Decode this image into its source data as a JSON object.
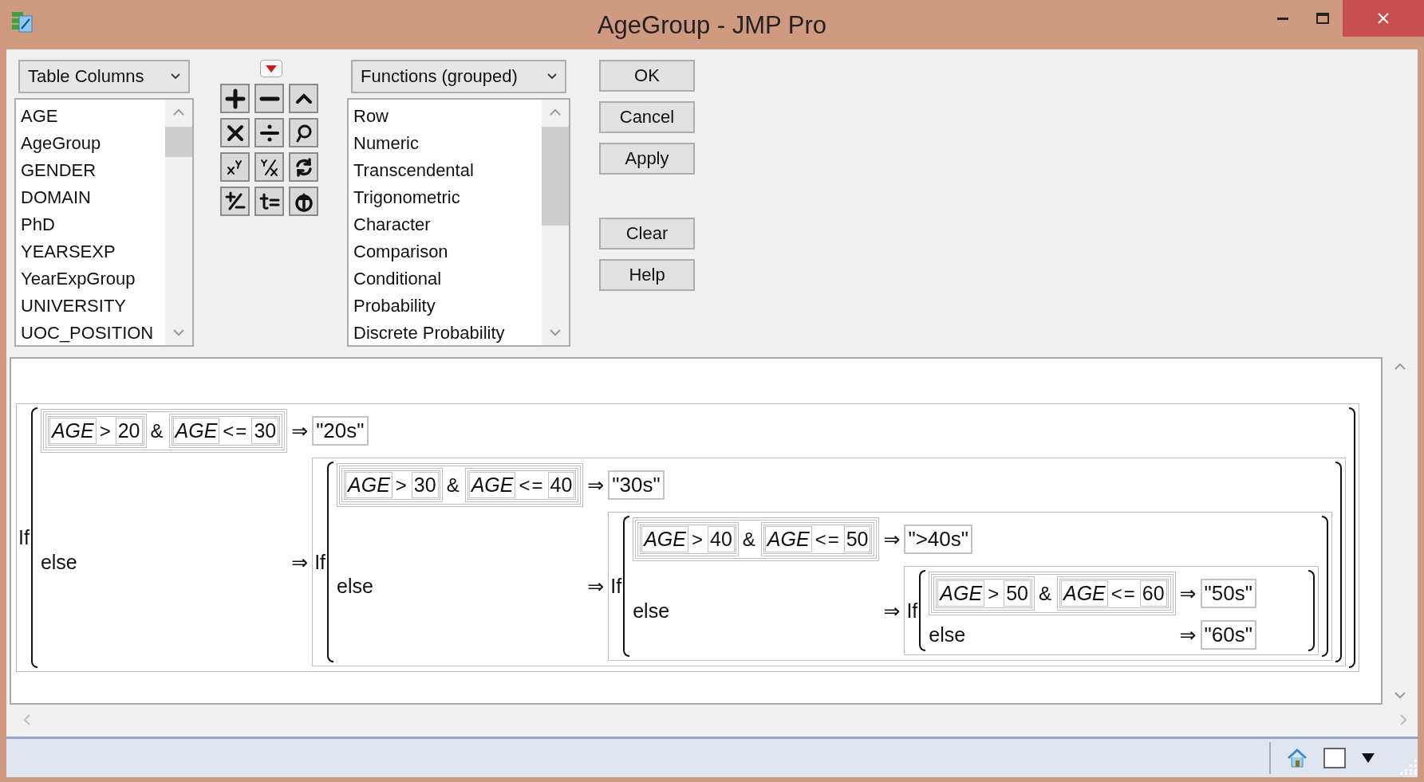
{
  "window": {
    "title": "AgeGroup - JMP Pro"
  },
  "columns_dropdown": {
    "label": "Table Columns"
  },
  "columns": [
    "AGE",
    "AgeGroup",
    "GENDER",
    "DOMAIN",
    "PhD",
    "YEARSEXP",
    "YearExpGroup",
    "UNIVERSITY",
    "UOC_POSITION"
  ],
  "keypad": [
    {
      "kind": "plus"
    },
    {
      "kind": "minus"
    },
    {
      "kind": "caret"
    },
    {
      "kind": "times"
    },
    {
      "kind": "divide"
    },
    {
      "kind": "lasso"
    },
    {
      "kind": "power"
    },
    {
      "kind": "root"
    },
    {
      "kind": "rotate"
    },
    {
      "kind": "plusminus"
    },
    {
      "kind": "assign"
    },
    {
      "kind": "extract"
    }
  ],
  "functions_dropdown": {
    "label": "Functions (grouped)"
  },
  "functions": [
    "Row",
    "Numeric",
    "Transcendental",
    "Trigonometric",
    "Character",
    "Comparison",
    "Conditional",
    "Probability",
    "Discrete Probability"
  ],
  "action_buttons": [
    "OK",
    "Cancel",
    "Apply"
  ],
  "utility_buttons": [
    "Clear",
    "Help"
  ],
  "formula": {
    "keyword": "If",
    "condition": {
      "joiner": "&",
      "terms": [
        {
          "column": "AGE",
          "op": ">",
          "value": "20"
        },
        {
          "column": "AGE",
          "op": "<=",
          "value": "30"
        }
      ]
    },
    "then_arrow": "⇒",
    "result": "\"20s\"",
    "else_label": "else",
    "else_arrow": "⇒",
    "else": {
      "keyword": "If",
      "condition": {
        "joiner": "&",
        "terms": [
          {
            "column": "AGE",
            "op": ">",
            "value": "30"
          },
          {
            "column": "AGE",
            "op": "<=",
            "value": "40"
          }
        ]
      },
      "then_arrow": "⇒",
      "result": "\"30s\"",
      "else_label": "else",
      "else_arrow": "⇒",
      "else": {
        "keyword": "If",
        "condition": {
          "joiner": "&",
          "terms": [
            {
              "column": "AGE",
              "op": ">",
              "value": "40"
            },
            {
              "column": "AGE",
              "op": "<=",
              "value": "50"
            }
          ]
        },
        "then_arrow": "⇒",
        "result": "\">40s\"",
        "else_label": "else",
        "else_arrow": "⇒",
        "else": {
          "keyword": "If",
          "condition": {
            "joiner": "&",
            "terms": [
              {
                "column": "AGE",
                "op": ">",
                "value": "50"
              },
              {
                "column": "AGE",
                "op": "<=",
                "value": "60"
              }
            ]
          },
          "then_arrow": "⇒",
          "result": "\"50s\"",
          "else_label": "else",
          "else_arrow": "⇒",
          "else_result": "\"60s\""
        }
      }
    }
  }
}
